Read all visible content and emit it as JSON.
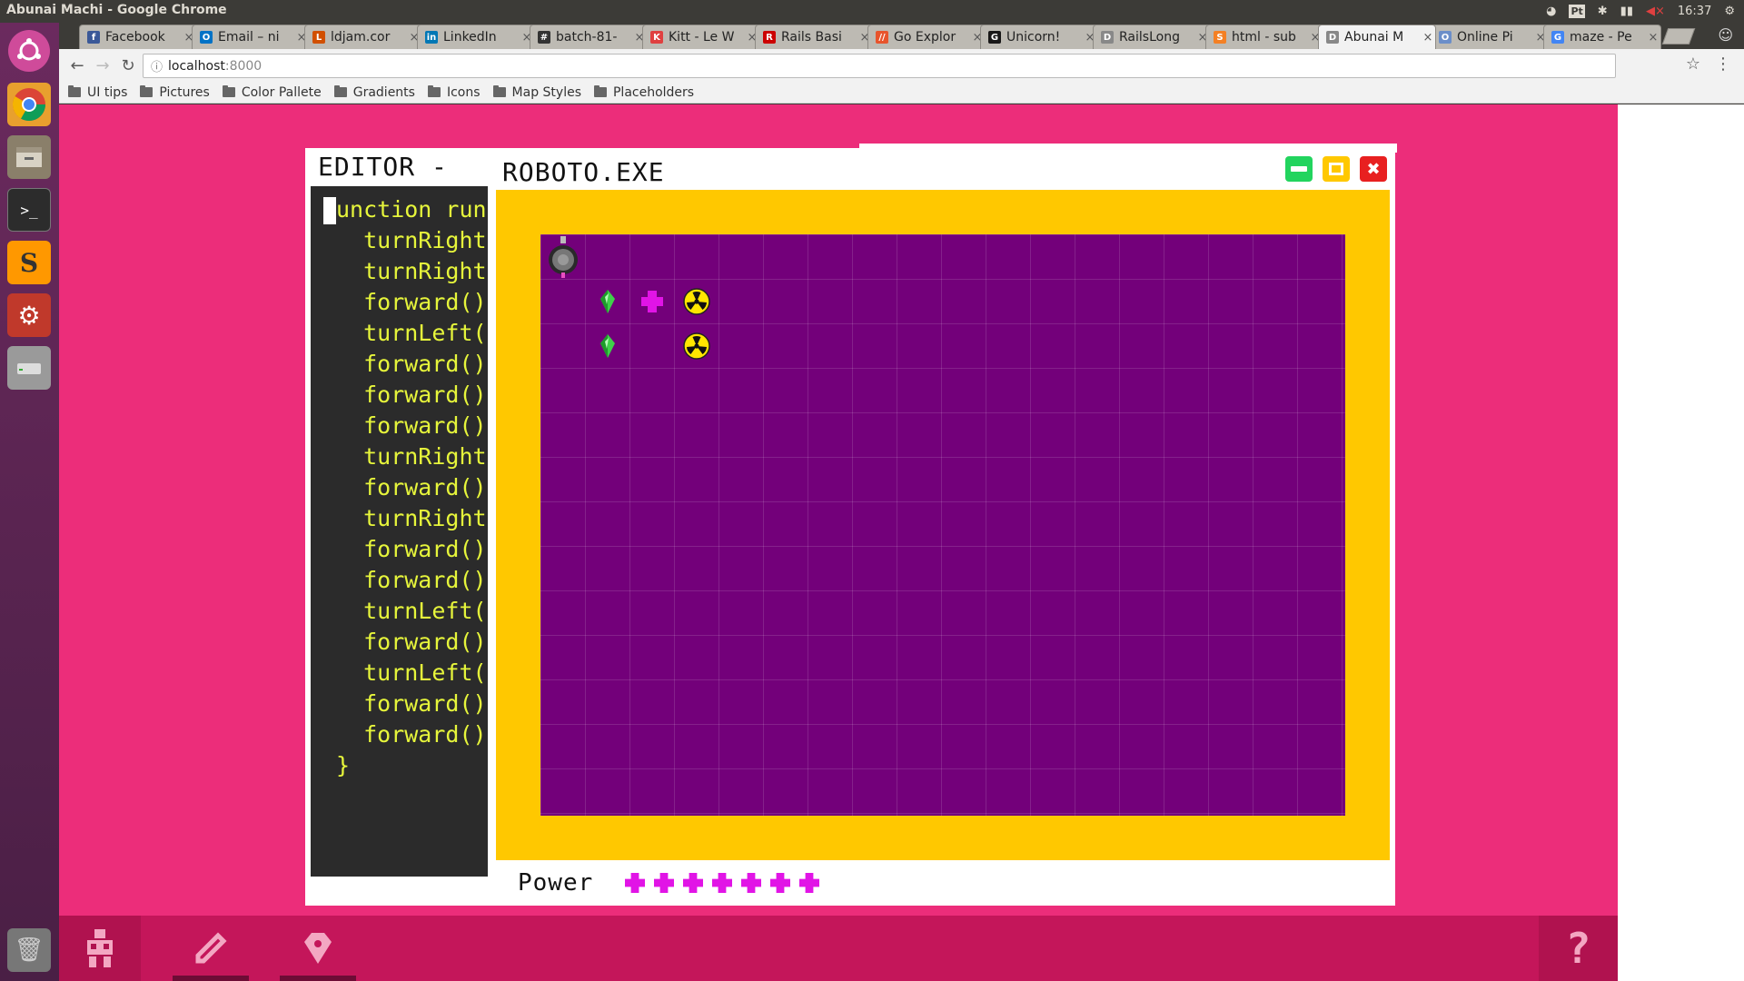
{
  "system": {
    "window_title": "Abunai Machi - Google Chrome",
    "lang_badge": "Pt",
    "clock": "16:37"
  },
  "tabs": [
    {
      "label": "Facebook",
      "fav_color": "#3b5998",
      "fav_glyph": "f"
    },
    {
      "label": "Email – ni",
      "fav_color": "#0072c6",
      "fav_glyph": "O"
    },
    {
      "label": "ldjam.cor",
      "fav_color": "#d14f00",
      "fav_glyph": "L"
    },
    {
      "label": "LinkedIn",
      "fav_color": "#0077b5",
      "fav_glyph": "in"
    },
    {
      "label": "batch-81-",
      "fav_color": "#333333",
      "fav_glyph": "#"
    },
    {
      "label": "Kitt - Le W",
      "fav_color": "#e04040",
      "fav_glyph": "K"
    },
    {
      "label": "Rails Basi",
      "fav_color": "#cc0000",
      "fav_glyph": "R"
    },
    {
      "label": "Go Explor",
      "fav_color": "#e8542c",
      "fav_glyph": "//"
    },
    {
      "label": "Unicorn!",
      "fav_color": "#181717",
      "fav_glyph": "G"
    },
    {
      "label": "RailsLong",
      "fav_color": "#888888",
      "fav_glyph": "D"
    },
    {
      "label": "html - sub",
      "fav_color": "#f48024",
      "fav_glyph": "S"
    },
    {
      "label": "Abunai M",
      "fav_color": "#888888",
      "fav_glyph": "D",
      "active": true
    },
    {
      "label": "Online Pi",
      "fav_color": "#6b8ec9",
      "fav_glyph": "O"
    },
    {
      "label": "maze - Pe",
      "fav_color": "#4285f4",
      "fav_glyph": "G"
    }
  ],
  "toolbar": {
    "url_host": "localhost",
    "url_port": ":8000"
  },
  "bookmarks": [
    "UI tips",
    "Pictures",
    "Color Pallete",
    "Gradients",
    "Icons",
    "Map Styles",
    "Placeholders"
  ],
  "app": {
    "editor_title": "EDITOR -",
    "window_title": "ROBOTO.EXE",
    "power_label": "Power",
    "power_level": 7,
    "code": "unction run\n  turnRight(\n  turnRight(\n  forward();\n  turnLeft()\n  forward();\n  forward();\n  forward();\n  turnRight(\n  forward();\n  turnRight(\n  forward();\n  forward();\n  turnLeft()\n  forward();\n  turnLeft()\n  forward();\n  forward();\n}",
    "grid": {
      "cols": 18,
      "rows": 13
    },
    "items": [
      {
        "type": "robot",
        "col": 0,
        "row": 0
      },
      {
        "type": "crystal",
        "col": 1,
        "row": 1
      },
      {
        "type": "power-cell",
        "col": 2,
        "row": 1
      },
      {
        "type": "radiation",
        "col": 3,
        "row": 1
      },
      {
        "type": "crystal",
        "col": 1,
        "row": 2
      },
      {
        "type": "radiation",
        "col": 3,
        "row": 2
      }
    ]
  },
  "dock": {
    "buttons": [
      "robot-icon",
      "pencil-icon",
      "gem-icon",
      "help-icon"
    ]
  }
}
